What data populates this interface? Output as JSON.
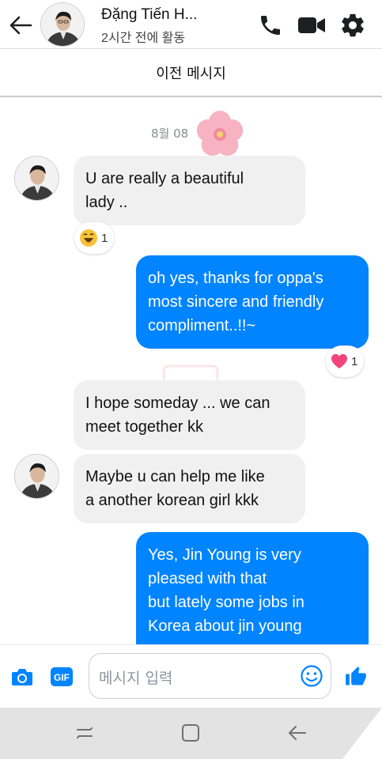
{
  "header": {
    "contact_name": "Đặng Tiến H...",
    "status": "2시간 전에 활동",
    "icons": [
      "back-arrow-icon",
      "phone-icon",
      "video-camera-icon",
      "gear-icon"
    ],
    "accent_color": "#0084ff"
  },
  "previous_messages_label": "이전 메시지",
  "date_label": "8월 08",
  "messages": [
    {
      "direction": "in",
      "text": "U are really a beautiful\nlady ..",
      "reaction": {
        "icon": "laughing-emoji-icon",
        "count": "1"
      }
    },
    {
      "direction": "out",
      "text": "oh yes, thanks for oppa's\nmost sincere and friendly\ncompliment..!!~",
      "reaction": {
        "icon": "heart-icon",
        "count": "1"
      }
    },
    {
      "direction": "in",
      "text": "I hope someday ... we can\nmeet together kk"
    },
    {
      "direction": "in",
      "text": "Maybe u can help me like\na another korean girl kkk"
    },
    {
      "direction": "out",
      "text": "Yes, Jin Young is very\npleased with that\nbut lately some jobs in\nKorea about jin young"
    }
  ],
  "composer": {
    "placeholder": "메시지 입력",
    "gif_label": "GIF",
    "icons": [
      "camera-icon",
      "gif-icon",
      "emoji-icon",
      "thumbs-up-icon"
    ]
  },
  "navbar": {
    "icons": [
      "recent-apps-icon",
      "home-icon",
      "back-icon"
    ]
  }
}
